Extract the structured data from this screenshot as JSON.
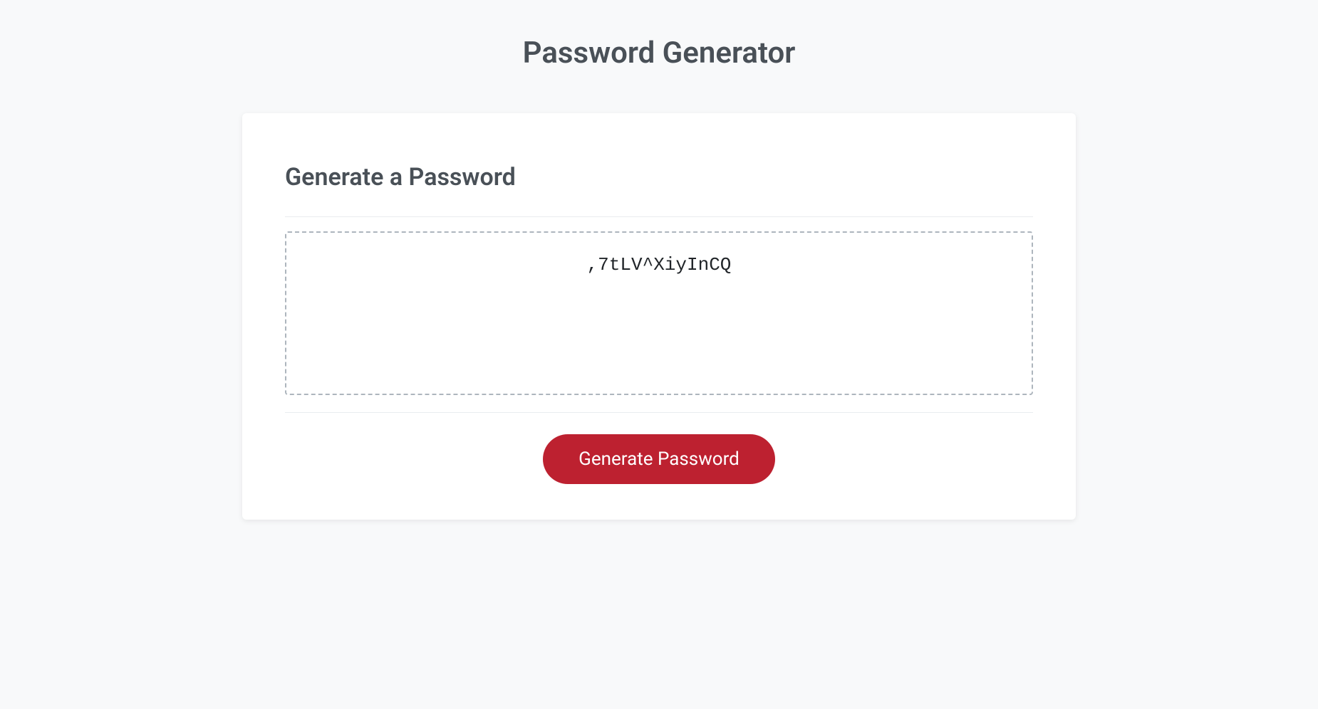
{
  "page": {
    "title": "Password Generator"
  },
  "card": {
    "heading": "Generate a Password",
    "password_value": ",7tLV^XiyInCQ",
    "button_label": "Generate Password"
  }
}
